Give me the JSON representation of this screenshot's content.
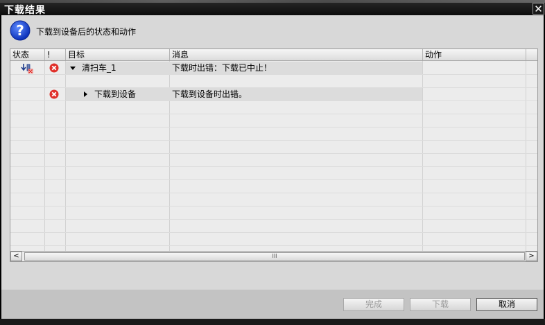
{
  "window": {
    "title": "下载结果"
  },
  "header": {
    "text": "下载到设备后的状态和动作"
  },
  "table": {
    "columns": [
      "状态",
      "!",
      "目标",
      "消息",
      "动作"
    ],
    "rows": [
      {
        "target": "清扫车_1",
        "message": "下载时出错：下载已中止！",
        "action": ""
      },
      {
        "target": "下载到设备",
        "message": "下载到设备时出错。",
        "action": ""
      }
    ]
  },
  "scrollbar": {
    "left_arrow": "<",
    "right_arrow": ">",
    "thumb_grip": "III"
  },
  "buttons": {
    "finish": "完成",
    "download": "下载",
    "cancel": "取消"
  },
  "colors": {
    "error_red": "#e0302a",
    "info_blue": "#1a4fd8"
  }
}
